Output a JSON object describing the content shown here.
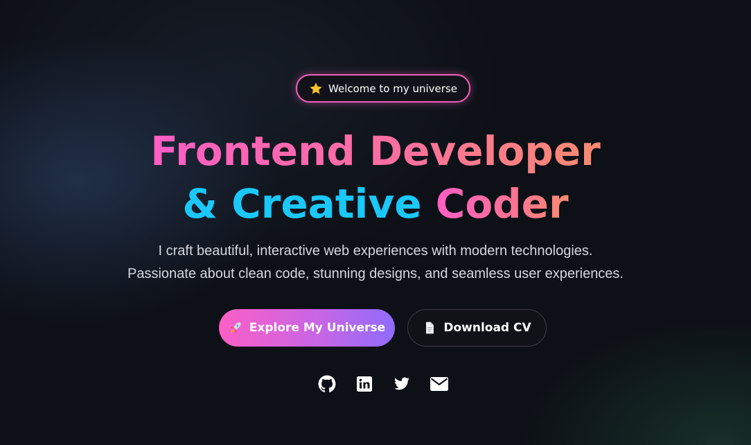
{
  "badge": {
    "icon": "star-icon",
    "text": "Welcome to my universe"
  },
  "headline": {
    "line1": "Frontend Developer",
    "line2_part1": "& Creative",
    "line2_part2": "Coder"
  },
  "subtitle": {
    "line1": "I craft beautiful, interactive web experiences with modern technologies.",
    "line2": "Passionate about clean code, stunning designs, and seamless user experiences."
  },
  "buttons": {
    "primary": {
      "icon": "rocket-icon",
      "label": "Explore My Universe"
    },
    "secondary": {
      "icon": "document-icon",
      "label": "Download CV"
    }
  },
  "socials": [
    {
      "name": "github-icon"
    },
    {
      "name": "linkedin-icon"
    },
    {
      "name": "twitter-icon"
    },
    {
      "name": "email-icon"
    }
  ],
  "colors": {
    "background": "#0d1016",
    "accent_pink": "#ff5ec4",
    "accent_orange": "#f98a70",
    "accent_cyan": "#1ac8fa",
    "accent_purple": "#8f6cfb",
    "subtitle_text": "#d5d8df"
  }
}
